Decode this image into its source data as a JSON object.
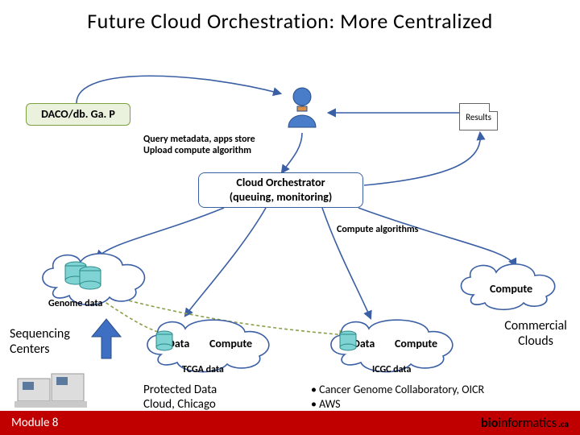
{
  "title": "Future Cloud Orchestration: More Centralized",
  "daco": "DACO/db. Ga. P",
  "results_doc": "Results",
  "query_caption_l1": "Query metadata, apps store",
  "query_caption_l2": "Upload compute algorithm",
  "orchestrator_l1": "Cloud Orchestrator",
  "orchestrator_l2": "(queuing, monitoring)",
  "compute_algorithms": "Compute algorithms",
  "genome_data": "Genome data",
  "compute": "Compute",
  "data": "Data",
  "tcga_data": "TCGA data",
  "icgc_data": "ICGC data",
  "sequencing_l1": "Sequencing",
  "sequencing_l2": "Centers",
  "commercial_l1": "Commercial",
  "commercial_l2": "Clouds",
  "protected_l1": "Protected Data",
  "protected_l2": "Cloud, Chicago",
  "bullet1": "Cancer Genome Collaboratory, OICR",
  "bullet2": "AWS",
  "footer_left": "Module 8",
  "brand_pre": "bio",
  "brand_suf": "informatics",
  "brand_ca": ".ca"
}
